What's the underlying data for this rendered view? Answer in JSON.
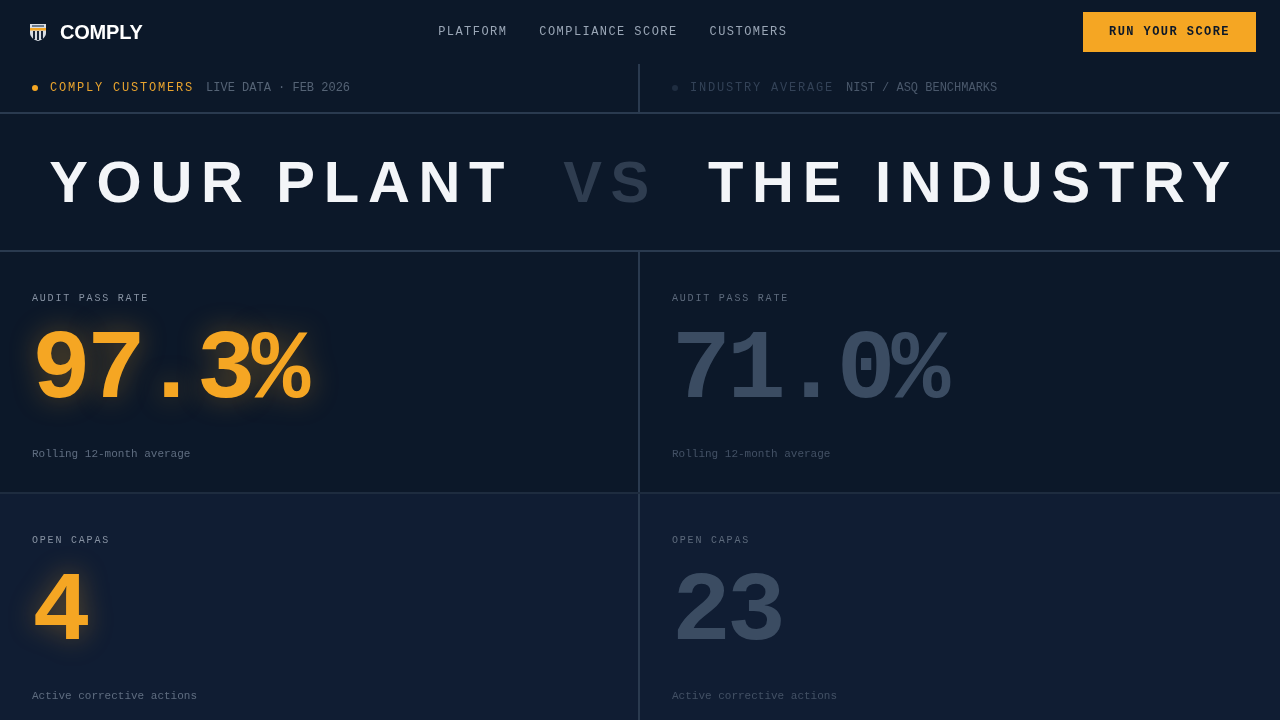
{
  "nav": {
    "logo": "COMPLY",
    "links": [
      "PLATFORM",
      "COMPLIANCE SCORE",
      "CUSTOMERS"
    ],
    "cta": "RUN YOUR SCORE"
  },
  "columns": [
    {
      "label": "COMPLY CUSTOMERS",
      "source": "LIVE DATA · FEB 2026",
      "highlighted": true
    },
    {
      "label": "INDUSTRY AVERAGE",
      "source": "NIST / ASQ BENCHMARKS",
      "highlighted": false
    }
  ],
  "headline": [
    {
      "text": "YOUR PLANT",
      "dim": false
    },
    {
      "text": "VS",
      "dim": true
    },
    {
      "text": "THE INDUSTRY",
      "dim": false
    }
  ],
  "metrics": [
    {
      "cells": [
        {
          "label": "AUDIT PASS RATE",
          "value": "97.3%",
          "note": "Rolling 12-month average"
        },
        {
          "label": "AUDIT PASS RATE",
          "value": "71.0%",
          "note": "Rolling 12-month average"
        }
      ]
    },
    {
      "cells": [
        {
          "label": "OPEN CAPAS",
          "value": "4",
          "note": "Active corrective actions"
        },
        {
          "label": "OPEN CAPAS",
          "value": "23",
          "note": "Active corrective actions"
        }
      ]
    }
  ]
}
